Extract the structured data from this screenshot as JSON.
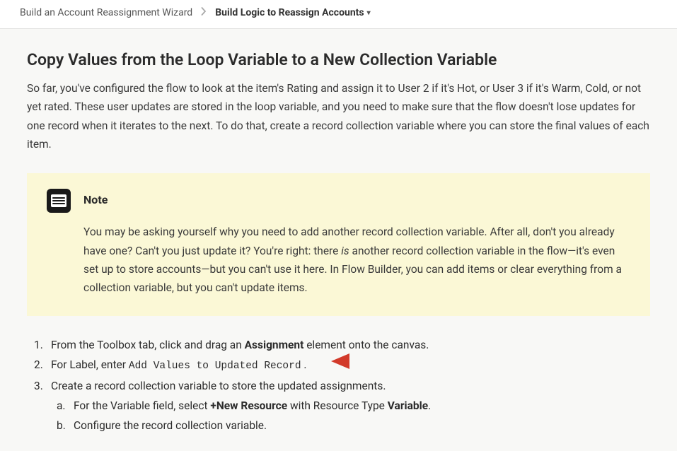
{
  "breadcrumb": {
    "parent": "Build an Account Reassignment Wizard",
    "current": "Build Logic to Reassign Accounts"
  },
  "page": {
    "title": "Copy Values from the Loop Variable to a New Collection Variable",
    "intro": "So far, you've configured the flow to look at the item's Rating and assign it to User 2 if it's Hot, or User 3 if it's Warm, Cold, or not yet rated. These user updates are stored in the loop variable, and you need to make sure that the flow doesn't lose updates for one record when it iterates to the next. To do that, create a record collection variable where you can store the final values of each item."
  },
  "note": {
    "title": "Note",
    "body_pre": "You may be asking yourself why you need to add another record collection variable. After all, don't you already have one? Can't you just update it? You're right: there ",
    "body_is": "is",
    "body_post": " another record collection variable in the flow—it's even set up to store accounts—but you can't use it here. In Flow Builder, you can add items or clear everything from a collection variable, but you can't update items."
  },
  "steps": {
    "s1_pre": "From the Toolbox tab, click and drag an ",
    "s1_strong": "Assignment",
    "s1_post": " element onto the canvas.",
    "s2_pre": "For Label, enter ",
    "s2_code": "Add Values to Updated Record",
    "s2_post": " .",
    "s3": "Create a record collection variable to store the updated assignments.",
    "s3a_pre": "For the Variable field, select ",
    "s3a_strong1": "+New Resource",
    "s3a_mid": " with Resource Type ",
    "s3a_strong2": "Variable",
    "s3a_post": ".",
    "s3b": "Configure the record collection variable."
  }
}
